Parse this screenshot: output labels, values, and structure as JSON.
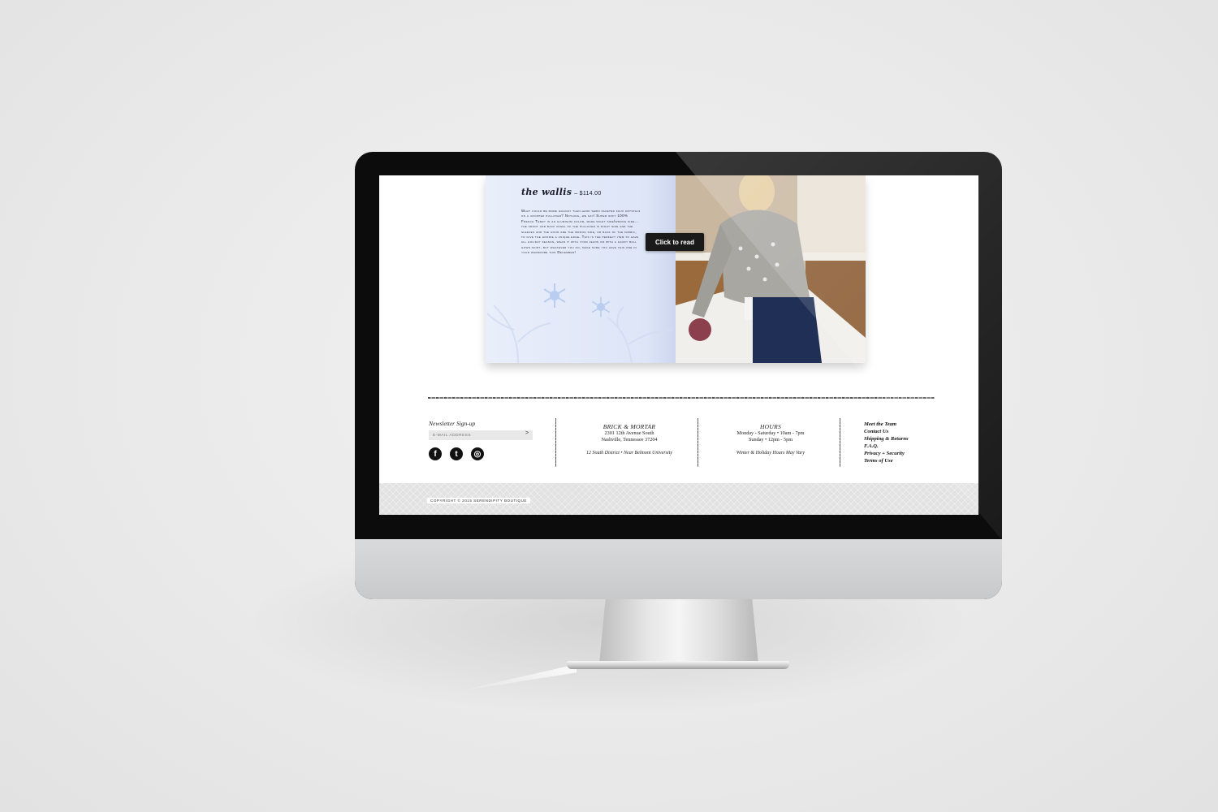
{
  "product": {
    "title": "the wallis",
    "price": "– $114.00",
    "description": "What could be more holiday than hand sewn faceted faux crystals on a cropped pullover? Nothing, we say! Super soft 100% French Terry in an aluminum color, made right side/wrong side... the front and back panel of the pullover is right side and the sleeves and the hood are the wrong side, or back of the fabric, to give the hoodie a unique edge. This is the perfect item to have all holiday season, wear it with your jeans or with a gaudy ball gown skirt, but whatever you do, make sure you have this one in your wardrobe this December!"
  },
  "book": {
    "read_button": "Click to read"
  },
  "newsletter": {
    "title": "Newsletter Sign-up",
    "placeholder": "E-MAIL ADDRESS",
    "submit": ">"
  },
  "social": {
    "facebook": "f",
    "twitter": "t",
    "instagram": "◎"
  },
  "store": {
    "title": "BRICK & MORTAR",
    "address1": "2301 12th Avenue South",
    "address2": "Nashville, Tennessee 37204",
    "note": "12 South District • Near Belmont University"
  },
  "hours": {
    "title": "HOURS",
    "line1": "Monday - Saturday • 10am - 7pm",
    "line2": "Sunday • 12pm - 5pm",
    "note": "Winter & Holiday Hours May Vary"
  },
  "links": [
    "Meet the Team",
    "Contact Us",
    "Shipping & Returns",
    "F.A.Q.",
    "Privacy + Security",
    "Terms of Use"
  ],
  "copyright": "COPYRIGHT © 2015 SERENDIPITY BOUTIQUE",
  "colors": {
    "page_bg": "#e9e9e9",
    "bezel": "#0c0c0c",
    "button": "#1a1a1a",
    "book_page": "#dde5f7"
  }
}
